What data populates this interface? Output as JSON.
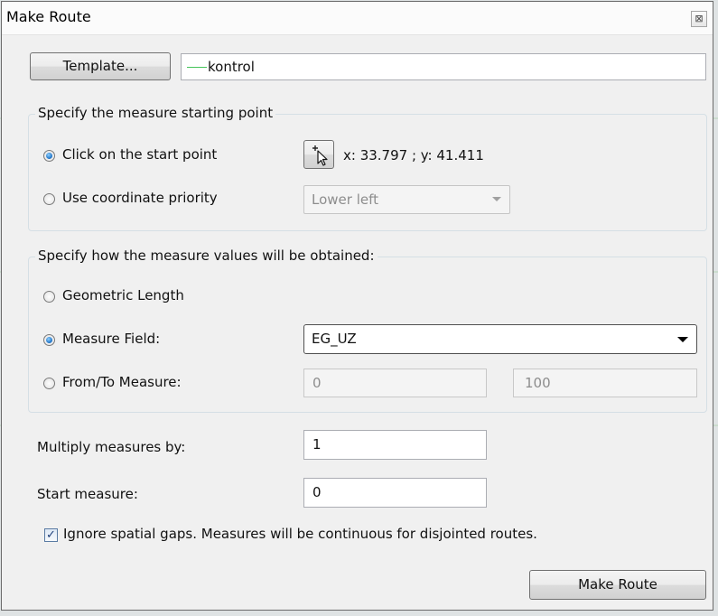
{
  "window": {
    "title": "Make Route",
    "close_glyph": "⊠"
  },
  "template": {
    "button_label": "Template...",
    "field_value": "kontrol",
    "line_color": "#45c45a"
  },
  "start_point": {
    "legend": "Specify the measure starting point",
    "click_option": "Click on the start point",
    "coordinate_readout": "x: 33.797 ; y: 41.411",
    "priority_option": "Use coordinate priority",
    "priority_value": "Lower left",
    "selected": "click_option"
  },
  "measure_values": {
    "legend": "Specify how the measure values will be obtained:",
    "geometric_option": "Geometric Length",
    "field_option": "Measure Field:",
    "field_value": "EG_UZ",
    "fromto_option": "From/To Measure:",
    "from_value": "0",
    "to_value": "100",
    "selected": "field_option"
  },
  "multiply": {
    "label": "Multiply measures by:",
    "value": "1"
  },
  "start_measure": {
    "label": "Start measure:",
    "value": "0"
  },
  "ignore_gaps": {
    "label": "Ignore spatial gaps. Measures will be continuous for disjointed routes.",
    "checked": true
  },
  "make_route_button": "Make Route",
  "colors": {
    "radio_selected": "#1b6fc3",
    "checkbox_mark": "#21407a",
    "window_bg": "#f0f0f0"
  },
  "icons": {
    "pick_point": "crosshair-cursor-icon",
    "checkmark": "checkmark-icon"
  }
}
